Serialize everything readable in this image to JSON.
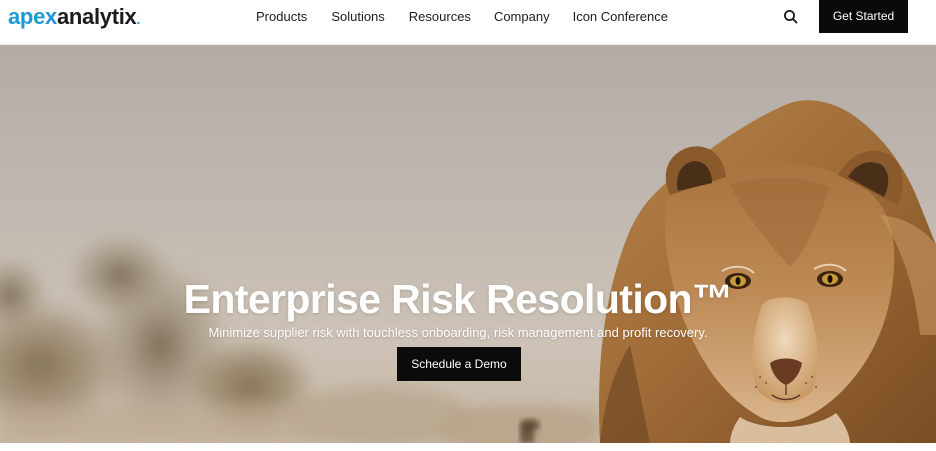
{
  "brand": {
    "logo_part1": "apex",
    "logo_part2": "analytix",
    "logo_mark": ".",
    "accent_color": "#1f98d6"
  },
  "nav": {
    "items": [
      {
        "label": "Products"
      },
      {
        "label": "Solutions"
      },
      {
        "label": "Resources"
      },
      {
        "label": "Company"
      },
      {
        "label": "Icon Conference"
      }
    ],
    "search_icon": "search-icon",
    "cta_label": "Get Started"
  },
  "hero": {
    "title": "Enterprise Risk Resolution™",
    "subtitle": "Minimize supplier risk with touchless onboarding, risk management and profit recovery.",
    "cta_label": "Schedule a Demo",
    "image": "lioness-walking-toward-camera"
  }
}
